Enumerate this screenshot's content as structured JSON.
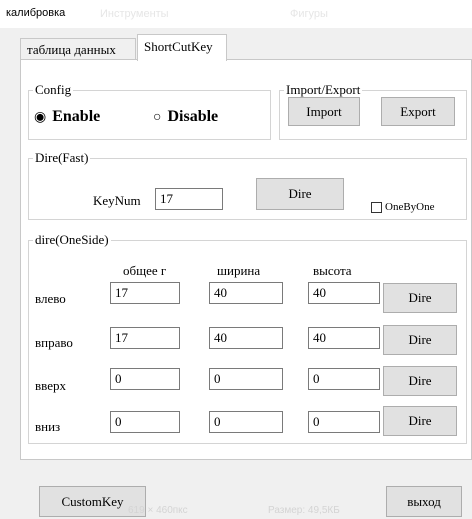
{
  "window": {
    "title": "калибровка",
    "faded_menu_1": "Инструменты",
    "faded_menu_2": "Фигуры"
  },
  "tabs": [
    {
      "label": "таблица данных",
      "active": false
    },
    {
      "label": "ShortCutKey",
      "active": true
    }
  ],
  "config": {
    "legend": "Config",
    "enable_label": "Enable",
    "disable_label": "Disable",
    "selected": "Enable",
    "enable_dot": "◉",
    "disable_dot": "○"
  },
  "import_export": {
    "legend": "Import/Export",
    "import_label": "Import",
    "export_label": "Export"
  },
  "dire_fast": {
    "legend": "Dire(Fast)",
    "keynum_label": "KeyNum",
    "keynum_value": "17",
    "dire_button": "Dire",
    "onebyone_label": "OneByOne",
    "onebyone_checked": false
  },
  "dire_oneside": {
    "legend": "dire(OneSide)",
    "headers": [
      "общее г",
      "ширина",
      "высота"
    ],
    "rows": [
      {
        "label": "влево",
        "values": [
          "17",
          "40",
          "40"
        ],
        "button": "Dire"
      },
      {
        "label": "вправо",
        "values": [
          "17",
          "40",
          "40"
        ],
        "button": "Dire"
      },
      {
        "label": "вверх",
        "values": [
          "0",
          "0",
          "0"
        ],
        "button": "Dire"
      },
      {
        "label": "вниз",
        "values": [
          "0",
          "0",
          "0"
        ],
        "button": "Dire"
      }
    ]
  },
  "footer": {
    "customkey_label": "CustomKey",
    "exit_label": "выход"
  },
  "statusbar": {
    "dimensions": "619 × 460пкс",
    "size": "Размер: 49,5КБ"
  }
}
